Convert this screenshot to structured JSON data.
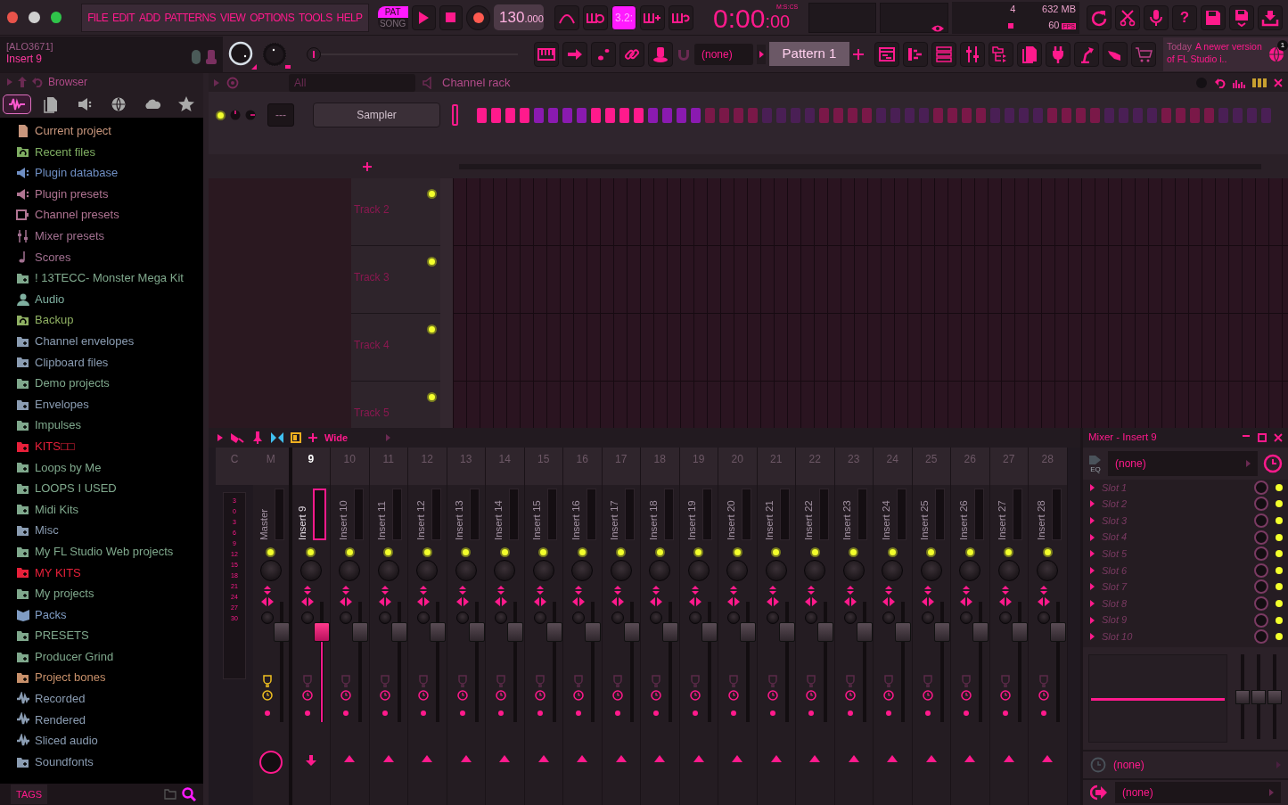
{
  "menu": [
    "FILE",
    "EDIT",
    "ADD",
    "PATTERNS",
    "VIEW",
    "OPTIONS",
    "TOOLS",
    "HELP"
  ],
  "mode": [
    {
      "label": "PAT",
      "selected": true
    },
    {
      "label": "SONG",
      "selected": false
    }
  ],
  "tempo": {
    "whole": "130",
    "fraction": ".000"
  },
  "step_counter": {
    "label": "3.2:",
    "on": true
  },
  "time": {
    "main": "0:00",
    "small": ":00",
    "format": "M:S:CS"
  },
  "monitor": {
    "cpu": "4",
    "memory": "632 MB",
    "fps": "60",
    "fps_badge": "FPS"
  },
  "help": "?",
  "hint": {
    "title": "[ALO3671]",
    "text": "Insert 9"
  },
  "master_pitch": {
    "level": 0
  },
  "snap": "(none)",
  "pattern": "Pattern 1",
  "news": {
    "date": "Today",
    "text": "A newer version of FL Studio i..",
    "badge": "1"
  },
  "browser": {
    "title": "Browser",
    "tabs": [
      {
        "kind": "wave",
        "selected": true
      },
      {
        "kind": "file",
        "selected": false
      },
      {
        "kind": "speaker",
        "selected": false
      },
      {
        "kind": "globe",
        "selected": false
      },
      {
        "kind": "cloud",
        "selected": false
      },
      {
        "kind": "star",
        "selected": false
      }
    ],
    "items": [
      {
        "label": "Current project",
        "kind": "file",
        "color": "#c8967c"
      },
      {
        "label": "Recent files",
        "kind": "folder-arrow",
        "color": "#7fae62"
      },
      {
        "label": "Plugin database",
        "kind": "speaker",
        "color": "#6f8fc4"
      },
      {
        "label": "Plugin presets",
        "kind": "speaker",
        "color": "#b07492"
      },
      {
        "label": "Channel presets",
        "kind": "panel",
        "color": "#b07492"
      },
      {
        "label": "Mixer presets",
        "kind": "sliders",
        "color": "#a27090"
      },
      {
        "label": "Scores",
        "kind": "note",
        "color": "#a27090"
      },
      {
        "label": "! 13TECC- Monster Mega Kit",
        "kind": "folder",
        "color": "#7fa88c"
      },
      {
        "label": "Audio",
        "kind": "person",
        "color": "#7fb0a0"
      },
      {
        "label": "Backup",
        "kind": "folder-arrow",
        "color": "#8fb062"
      },
      {
        "label": "Channel envelopes",
        "kind": "folder",
        "color": "#8a9cb2"
      },
      {
        "label": "Clipboard files",
        "kind": "folder",
        "color": "#8a9cb2"
      },
      {
        "label": "Demo projects",
        "kind": "folder",
        "color": "#7fa88c"
      },
      {
        "label": "Envelopes",
        "kind": "folder",
        "color": "#8a9cb2"
      },
      {
        "label": "Impulses",
        "kind": "folder",
        "color": "#7fa88c"
      },
      {
        "label": "KITS□□",
        "kind": "folder",
        "color": "#e8203a"
      },
      {
        "label": "Loops by Me",
        "kind": "folder",
        "color": "#7fa88c"
      },
      {
        "label": "LOOPS I USED",
        "kind": "folder",
        "color": "#7fa88c"
      },
      {
        "label": "Midi Kits",
        "kind": "folder",
        "color": "#7fa88c"
      },
      {
        "label": "Misc",
        "kind": "folder",
        "color": "#8a9cb2"
      },
      {
        "label": "My FL Studio Web projects",
        "kind": "folder",
        "color": "#7fa88c"
      },
      {
        "label": "MY KITS",
        "kind": "folder",
        "color": "#e8203a"
      },
      {
        "label": "My projects",
        "kind": "folder",
        "color": "#7fa88c"
      },
      {
        "label": "Packs",
        "kind": "package",
        "color": "#7f9cc4"
      },
      {
        "label": "PRESETS",
        "kind": "folder",
        "color": "#7fa88c"
      },
      {
        "label": "Producer Grind",
        "kind": "folder",
        "color": "#7fa88c"
      },
      {
        "label": "Project bones",
        "kind": "folder",
        "color": "#c8906a"
      },
      {
        "label": "Recorded",
        "kind": "wave",
        "color": "#8a9cb2"
      },
      {
        "label": "Rendered",
        "kind": "wave",
        "color": "#8a9cb2"
      },
      {
        "label": "Sliced audio",
        "kind": "wave",
        "color": "#8a9cb2"
      },
      {
        "label": "Soundfonts",
        "kind": "folder",
        "color": "#8a9cb2"
      }
    ],
    "footer": "TAGS"
  },
  "channel_rack": {
    "title": "Channel rack",
    "filter": "All",
    "channels": [
      {
        "name": "Sampler",
        "swing": "---",
        "steps": [
          {
            "on": true
          },
          {
            "on": true
          },
          {
            "on": true
          },
          {
            "on": true
          },
          {
            "on": true
          },
          {
            "on": true
          },
          {
            "on": true
          },
          {
            "on": true
          },
          {
            "on": true
          },
          {
            "on": true
          },
          {
            "on": true
          },
          {
            "on": true
          },
          {
            "on": true
          },
          {
            "on": true
          },
          {
            "on": true
          },
          {
            "on": true
          },
          {
            "on": false
          },
          {
            "on": false
          },
          {
            "on": false
          },
          {
            "on": false
          },
          {
            "on": false
          },
          {
            "on": false
          },
          {
            "on": false
          },
          {
            "on": false
          },
          {
            "on": false
          },
          {
            "on": false
          },
          {
            "on": false
          },
          {
            "on": false
          },
          {
            "on": false
          },
          {
            "on": false
          },
          {
            "on": false
          },
          {
            "on": false
          },
          {
            "on": false
          },
          {
            "on": false
          },
          {
            "on": false
          },
          {
            "on": false
          },
          {
            "on": false
          },
          {
            "on": false
          },
          {
            "on": false
          },
          {
            "on": false
          },
          {
            "on": false
          },
          {
            "on": false
          },
          {
            "on": false
          },
          {
            "on": false
          },
          {
            "on": false
          },
          {
            "on": false
          },
          {
            "on": false
          },
          {
            "on": false
          },
          {
            "on": false
          },
          {
            "on": false
          },
          {
            "on": false
          },
          {
            "on": false
          },
          {
            "on": false
          },
          {
            "on": false
          },
          {
            "on": false
          },
          {
            "on": false
          }
        ]
      }
    ]
  },
  "playlist": {
    "tracks": [
      "Track 2",
      "Track 3",
      "Track 4",
      "Track 5"
    ]
  },
  "mixer": {
    "mode": "Wide",
    "scale_label": "C",
    "scale": [
      "3",
      "0",
      "3",
      "6",
      "9",
      "12",
      "15",
      "18",
      "21",
      "24",
      "27",
      "30"
    ],
    "strips": [
      {
        "number": "M",
        "name": "Master",
        "kind": "master",
        "selected": false,
        "level": 0.8
      },
      {
        "number": "9",
        "name": "Insert 9",
        "kind": "insert",
        "selected": true,
        "level": 0.8
      },
      {
        "number": "10",
        "name": "Insert 10",
        "kind": "insert",
        "selected": false,
        "level": 0.8
      },
      {
        "number": "11",
        "name": "Insert 11",
        "kind": "insert",
        "selected": false,
        "level": 0.8
      },
      {
        "number": "12",
        "name": "Insert 12",
        "kind": "insert",
        "selected": false,
        "level": 0.8
      },
      {
        "number": "13",
        "name": "Insert 13",
        "kind": "insert",
        "selected": false,
        "level": 0.8
      },
      {
        "number": "14",
        "name": "Insert 14",
        "kind": "insert",
        "selected": false,
        "level": 0.8
      },
      {
        "number": "15",
        "name": "Insert 15",
        "kind": "insert",
        "selected": false,
        "level": 0.8
      },
      {
        "number": "16",
        "name": "Insert 16",
        "kind": "insert",
        "selected": false,
        "level": 0.8
      },
      {
        "number": "17",
        "name": "Insert 17",
        "kind": "insert",
        "selected": false,
        "level": 0.8
      },
      {
        "number": "18",
        "name": "Insert 18",
        "kind": "insert",
        "selected": false,
        "level": 0.8
      },
      {
        "number": "19",
        "name": "Insert 19",
        "kind": "insert",
        "selected": false,
        "level": 0.8
      },
      {
        "number": "20",
        "name": "Insert 20",
        "kind": "insert",
        "selected": false,
        "level": 0.8
      },
      {
        "number": "21",
        "name": "Insert 21",
        "kind": "insert",
        "selected": false,
        "level": 0.8
      },
      {
        "number": "22",
        "name": "Insert 22",
        "kind": "insert",
        "selected": false,
        "level": 0.8
      },
      {
        "number": "23",
        "name": "Insert 23",
        "kind": "insert",
        "selected": false,
        "level": 0.8
      },
      {
        "number": "24",
        "name": "Insert 24",
        "kind": "insert",
        "selected": false,
        "level": 0.8
      },
      {
        "number": "25",
        "name": "Insert 25",
        "kind": "insert",
        "selected": false,
        "level": 0.8
      },
      {
        "number": "26",
        "name": "Insert 26",
        "kind": "insert",
        "selected": false,
        "level": 0.8
      },
      {
        "number": "27",
        "name": "Insert 27",
        "kind": "insert",
        "selected": false,
        "level": 0.8
      },
      {
        "number": "28",
        "name": "Insert 28",
        "kind": "insert",
        "selected": false,
        "level": 0.8
      }
    ],
    "insert": {
      "title": "Mixer - Insert 9",
      "eq_label": "EQ",
      "input": "(none)",
      "slots": [
        "Slot 1",
        "Slot 2",
        "Slot 3",
        "Slot 4",
        "Slot 5",
        "Slot 6",
        "Slot 7",
        "Slot 8",
        "Slot 9",
        "Slot 10"
      ],
      "eq_bands": [
        {
          "level": 0.5
        },
        {
          "level": 0.5
        },
        {
          "level": 0.5
        }
      ],
      "track_input": "(none)",
      "output": "(none)"
    }
  }
}
